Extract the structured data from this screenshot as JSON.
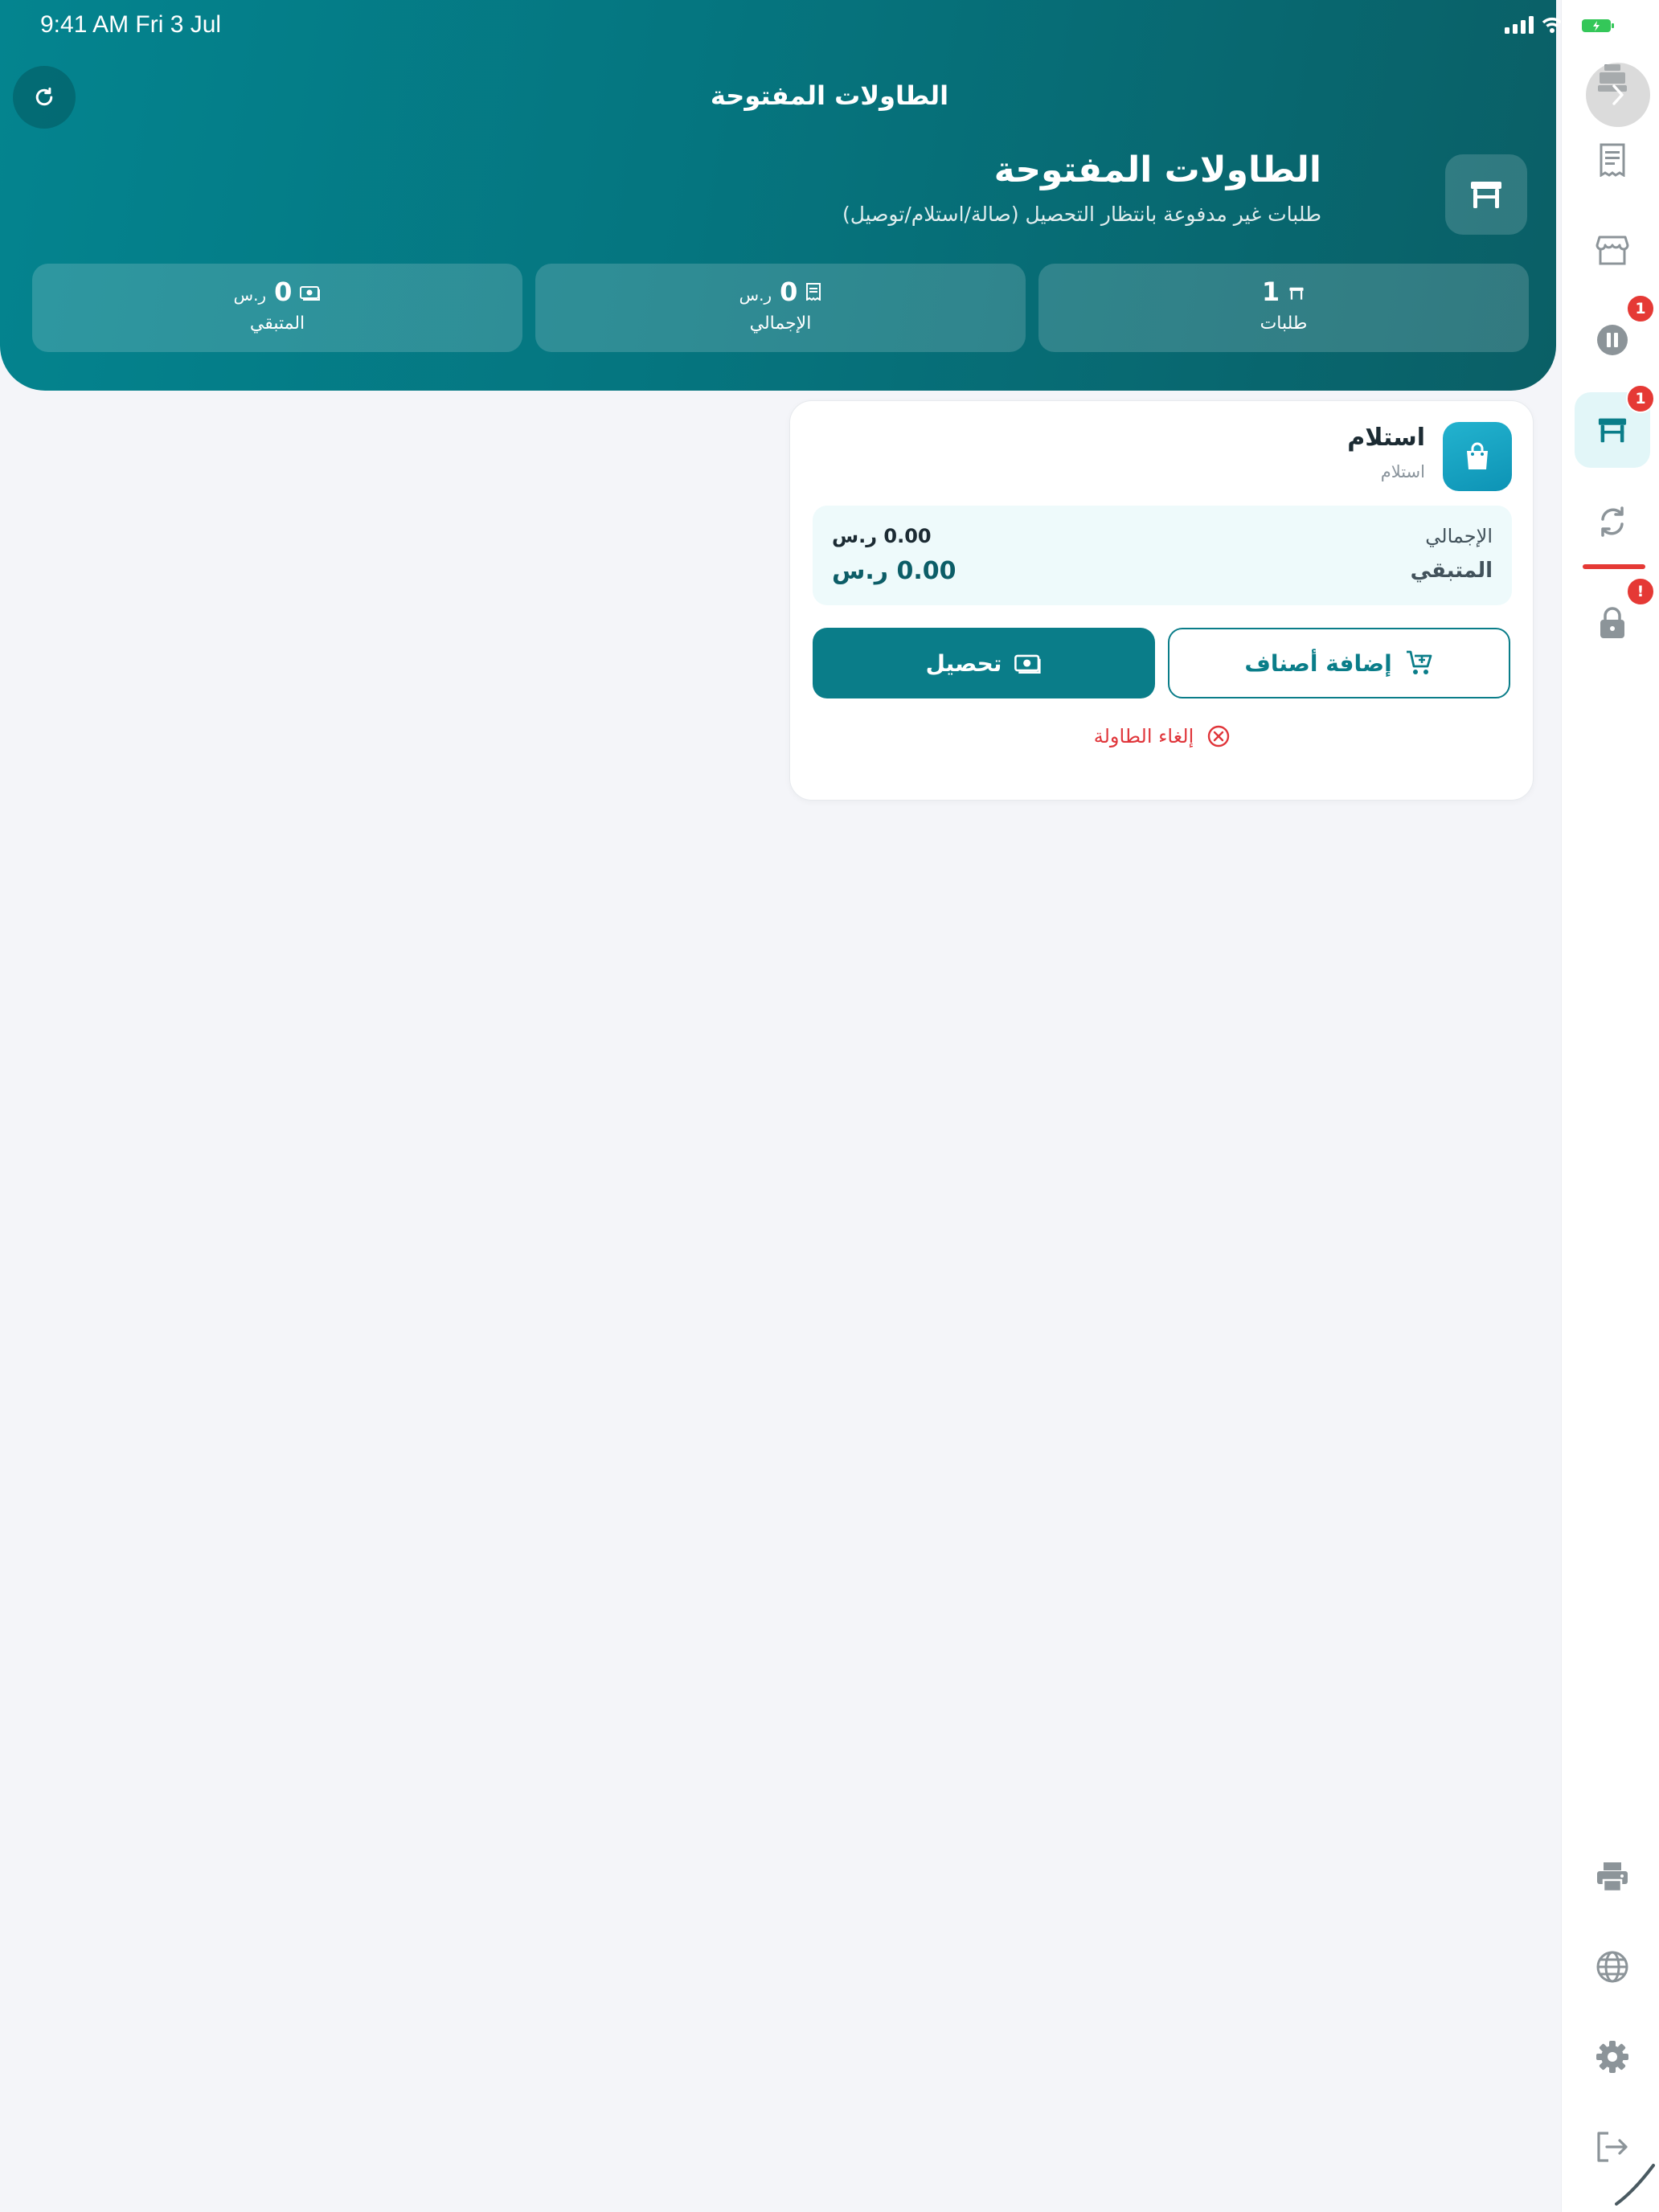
{
  "status_bar": {
    "time": "9:41 AM   Fri 3 Jul"
  },
  "header": {
    "nav_title": "الطاولات المفتوحة",
    "title": "الطاولات المفتوحة",
    "subtitle": "طلبات غير مدفوعة بانتظار التحصيل (صالة/استلام/توصيل)",
    "stats": [
      {
        "value": "1",
        "unit": "",
        "label": "طلبات",
        "icon": "table-icon"
      },
      {
        "value": "0",
        "unit": "ر.س",
        "label": "الإجمالي",
        "icon": "receipt-icon"
      },
      {
        "value": "0",
        "unit": "ر.س",
        "label": "المتبقي",
        "icon": "cash-icon"
      }
    ]
  },
  "order_card": {
    "title": "استلام",
    "subtitle": "استلام",
    "total_label": "الإجمالي",
    "total_value": "0.00 ر.س",
    "remaining_label": "المتبقي",
    "remaining_value": "0.00 ر.س",
    "add_items_label": "إضافة أصناف",
    "collect_label": "تحصيل",
    "cancel_label": "إلغاء الطاولة"
  },
  "sidebar": {
    "items": [
      {
        "icon": "cash-register-icon"
      },
      {
        "icon": "receipt-list-icon"
      },
      {
        "icon": "store-icon"
      },
      {
        "icon": "pause-icon",
        "badge": "1"
      },
      {
        "icon": "table-icon",
        "badge": "1",
        "active": true
      },
      {
        "icon": "sync-icon"
      },
      {
        "icon": "lock-icon",
        "badge": "!"
      },
      {
        "icon": "printer-icon"
      },
      {
        "icon": "globe-icon"
      },
      {
        "icon": "settings-icon"
      },
      {
        "icon": "logout-icon"
      }
    ]
  },
  "colors": {
    "primary": "#0a7d89",
    "header_start": "#04848f",
    "header_end": "#0a5f66",
    "danger": "#e53935",
    "background": "#f4f5f9"
  }
}
